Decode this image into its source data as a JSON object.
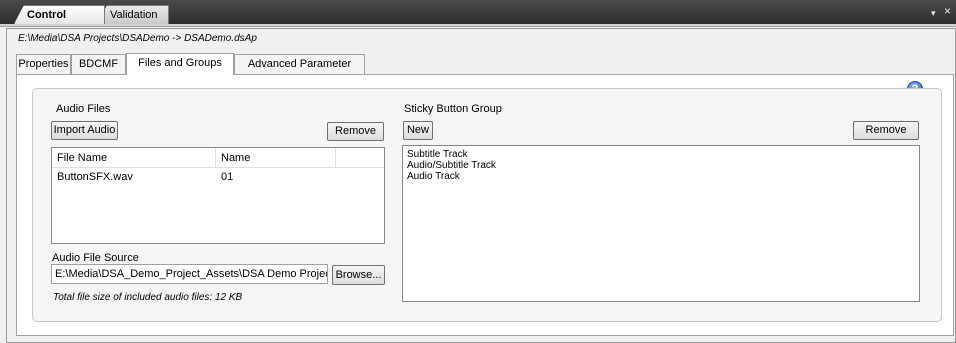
{
  "doc_tabs": [
    {
      "label": "Control Panel",
      "active": true
    },
    {
      "label": "Validation",
      "active": false
    }
  ],
  "window_controls": {
    "dropdown": "▾",
    "close": "×"
  },
  "project_path": "E:\\Media\\DSA Projects\\DSADemo -> DSADemo.dsAp",
  "tabs": [
    {
      "label": "Properties",
      "selected": false
    },
    {
      "label": "BDCMF",
      "selected": false
    },
    {
      "label": "Files and Groups",
      "selected": true
    },
    {
      "label": "Advanced Parameter",
      "selected": false
    }
  ],
  "help_icon": "?",
  "audio_files": {
    "title": "Audio Files",
    "import_label": "Import Audio",
    "remove_label": "Remove",
    "columns": [
      "File Name",
      "Name"
    ],
    "rows": [
      {
        "file_name": "ButtonSFX.wav",
        "name": "01"
      }
    ],
    "source_label": "Audio File Source",
    "source_value": "E:\\Media\\DSA_Demo_Project_Assets\\DSA Demo Project\\DSA",
    "browse_label": "Browse...",
    "total_note": "Total file size of included audio files: 12 KB"
  },
  "sticky_group": {
    "title": "Sticky Button Group",
    "new_label": "New",
    "remove_label": "Remove",
    "items": [
      "Subtitle Track",
      "Audio/Subtitle Track",
      "Audio Track"
    ]
  }
}
